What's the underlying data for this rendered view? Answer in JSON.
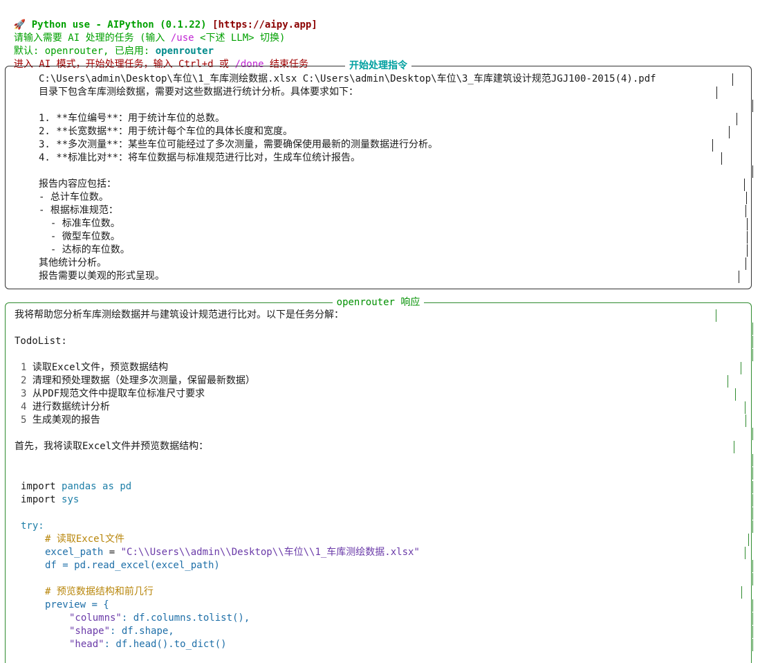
{
  "header": {
    "rocket_icon": "rocket-icon",
    "title": "Python use - AIPython (0.1.22)",
    "url": "[https://aipy.app]",
    "prompt_line_a": "请输入需要 AI 处理的任务 (输入 ",
    "prompt_line_cmd": "/use",
    "prompt_line_b": " <下述 LLM> 切换)",
    "default_prefix": "默认: openrouter, 已启用: ",
    "default_enabled": "openrouter",
    "mode_a": "进入 AI 模式，开始处理任务，输入 Ctrl+d 或 ",
    "mode_done": "/done",
    "mode_b": " 结束任务"
  },
  "instruction_panel": {
    "title": "开始处理指令",
    "lines": [
      "C:\\Users\\admin\\Desktop\\车位\\1_车库测绘数据.xlsx C:\\Users\\admin\\Desktop\\车位\\3_车库建筑设计规范JGJ100-2015(4).pdf",
      "目录下包含车库测绘数据，需要对这些数据进行统计分析。具体要求如下：",
      "",
      "1. **车位编号**：用于统计车位的总数。",
      "2. **长宽数据**：用于统计每个车位的具体长度和宽度。",
      "3. **多次测量**：某些车位可能经过了多次测量，需要确保使用最新的测量数据进行分析。",
      "4. **标准比对**：将车位数据与标准规范进行比对，生成车位统计报告。",
      "",
      "报告内容应包括：",
      "- 总计车位数。",
      "- 根据标准规范：",
      "  - 标准车位数。",
      "  - 微型车位数。",
      "  - 达标的车位数。",
      "其他统计分析。",
      "报告需要以美观的形式呈现。"
    ]
  },
  "response_panel": {
    "title": "openrouter 响应",
    "intro": "我将帮助您分析车库测绘数据并与建筑设计规范进行比对。以下是任务分解：",
    "todo_heading": "TodoList:",
    "todo_items": [
      {
        "num": "1",
        "text": "读取Excel文件，预览数据结构"
      },
      {
        "num": "2",
        "text": "清理和预处理数据（处理多次测量，保留最新数据）"
      },
      {
        "num": "3",
        "text": "从PDF规范文件中提取车位标准尺寸要求"
      },
      {
        "num": "4",
        "text": "进行数据统计分析"
      },
      {
        "num": "5",
        "text": "生成美观的报告"
      }
    ],
    "first_step": "首先，我将读取Excel文件并预览数据结构：",
    "code": {
      "l1_kw": "import",
      "l1_mod": "pandas",
      "l1_as": "as",
      "l1_alias": "pd",
      "l2_kw": "import",
      "l2_mod": "sys",
      "l3": "try:",
      "l4": "# 读取Excel文件",
      "l5_var": "excel_path",
      "l5_eq": " = ",
      "l5_str": "\"C:\\\\Users\\\\admin\\\\Desktop\\\\车位\\\\1_车库测绘数据.xlsx\"",
      "l6_var": "df",
      "l6_rest": " = pd.read_excel(excel_path)",
      "l7": "# 预览数据结构和前几行",
      "l8_var": "preview",
      "l8_rest": " = {",
      "l9_str": "\"columns\"",
      "l9_rest": ": df.columns.tolist(),",
      "l10_str": "\"shape\"",
      "l10_rest": ": df.shape,",
      "l11_str": "\"head\"",
      "l11_rest": ": df.head().to_dict()"
    }
  }
}
